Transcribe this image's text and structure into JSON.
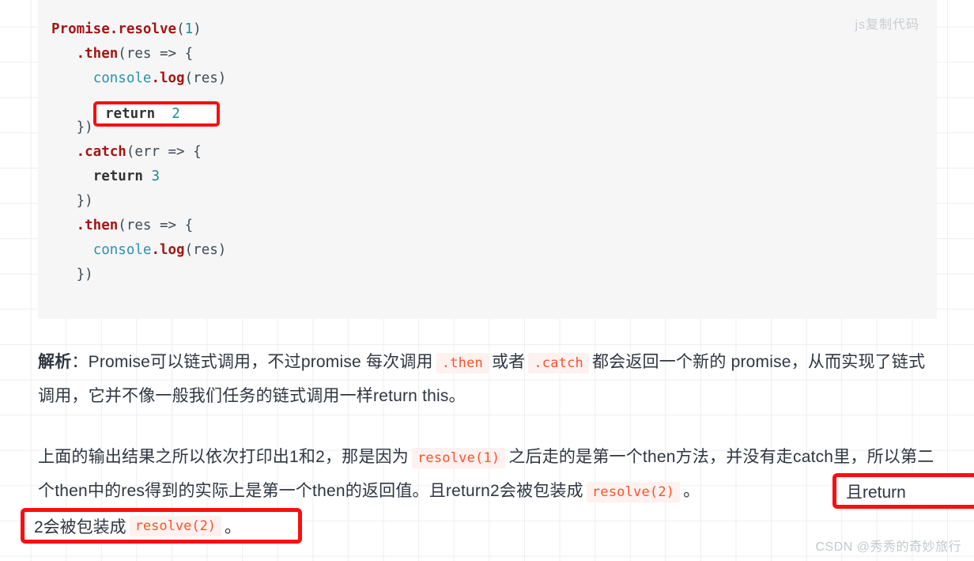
{
  "code_block": {
    "copy_label": "js复制代码",
    "language": "js",
    "background": "#f6f6f6",
    "lines": [
      [
        {
          "t": "Promise",
          "c": "tok-cls"
        },
        {
          "t": ".",
          "c": "tok-cls"
        },
        {
          "t": "resolve",
          "c": "tok-cls"
        },
        {
          "t": "(",
          "c": "tok-punc"
        },
        {
          "t": "1",
          "c": "tok-num2"
        },
        {
          "t": ")",
          "c": "tok-punc"
        }
      ],
      [
        {
          "t": "   ",
          "c": "tok-punc"
        },
        {
          "t": ".then",
          "c": "tok-cls"
        },
        {
          "t": "(",
          "c": "tok-punc"
        },
        {
          "t": "res",
          "c": "tok-var"
        },
        {
          "t": " => ",
          "c": "tok-punc"
        },
        {
          "t": "{",
          "c": "tok-punc"
        }
      ],
      [
        {
          "t": "     ",
          "c": "tok-punc"
        },
        {
          "t": "console",
          "c": "tok-obj"
        },
        {
          "t": ".log",
          "c": "tok-cls"
        },
        {
          "t": "(",
          "c": "tok-punc"
        },
        {
          "t": "res",
          "c": "tok-var"
        },
        {
          "t": ")",
          "c": "tok-punc"
        }
      ],
      [
        {
          "t": "     ",
          "c": "tok-punc"
        },
        {
          "t": "return",
          "c": "tok-kw"
        },
        {
          "t": " ",
          "c": "tok-punc"
        },
        {
          "t": "2",
          "c": "tok-num2"
        }
      ],
      [
        {
          "t": "   ",
          "c": "tok-punc"
        },
        {
          "t": "})",
          "c": "tok-punc"
        }
      ],
      [
        {
          "t": "   ",
          "c": "tok-punc"
        },
        {
          "t": ".catch",
          "c": "tok-cls"
        },
        {
          "t": "(",
          "c": "tok-punc"
        },
        {
          "t": "err",
          "c": "tok-var"
        },
        {
          "t": " => ",
          "c": "tok-punc"
        },
        {
          "t": "{",
          "c": "tok-punc"
        }
      ],
      [
        {
          "t": "     ",
          "c": "tok-punc"
        },
        {
          "t": "return",
          "c": "tok-kw"
        },
        {
          "t": " ",
          "c": "tok-punc"
        },
        {
          "t": "3",
          "c": "tok-num2"
        }
      ],
      [
        {
          "t": "   ",
          "c": "tok-punc"
        },
        {
          "t": "})",
          "c": "tok-punc"
        }
      ],
      [
        {
          "t": "   ",
          "c": "tok-punc"
        },
        {
          "t": ".then",
          "c": "tok-cls"
        },
        {
          "t": "(",
          "c": "tok-punc"
        },
        {
          "t": "res",
          "c": "tok-var"
        },
        {
          "t": " => ",
          "c": "tok-punc"
        },
        {
          "t": "{",
          "c": "tok-punc"
        }
      ],
      [
        {
          "t": "     ",
          "c": "tok-punc"
        },
        {
          "t": "console",
          "c": "tok-obj"
        },
        {
          "t": ".log",
          "c": "tok-cls"
        },
        {
          "t": "(",
          "c": "tok-punc"
        },
        {
          "t": "res",
          "c": "tok-var"
        },
        {
          "t": ")",
          "c": "tok-punc"
        }
      ],
      [
        {
          "t": "   ",
          "c": "tok-punc"
        },
        {
          "t": "})",
          "c": "tok-punc"
        }
      ]
    ],
    "highlight_box": {
      "keyword": "return",
      "value": "2",
      "border_color": "#fb0e0e"
    }
  },
  "prose": {
    "paragraph1": {
      "label": "解析",
      "colon": "：",
      "seg1": "Promise可以链式调用，不过promise 每次调用",
      "code1": ".then",
      "seg2": "或者",
      "code2": ".catch",
      "seg3": "都会返回一个新的 promise，从而实现了链式调用，它并不像一般我们任务的链式调用一样return this。"
    },
    "paragraph2": {
      "seg1": "上面的输出结果之所以依次打印出1和2，那是因为",
      "code1": "resolve(1)",
      "seg2": "之后走的是第一个then方法，并没有走catch里，所以第二个then中的res得到的实际上是第一个then的返回值。",
      "seg3": "且return2会被包装成",
      "code2": "resolve(2)",
      "seg4": "。"
    }
  },
  "annotations": {
    "box_prose_1_text": "且return",
    "box_prose_2_prefix": "2会被包装成",
    "box_prose_2_code": "resolve(2)",
    "box_prose_2_suffix": "。",
    "border_color": "#fb0e0e"
  },
  "watermark": {
    "text": "CSDN @秀秀的奇妙旅行"
  }
}
